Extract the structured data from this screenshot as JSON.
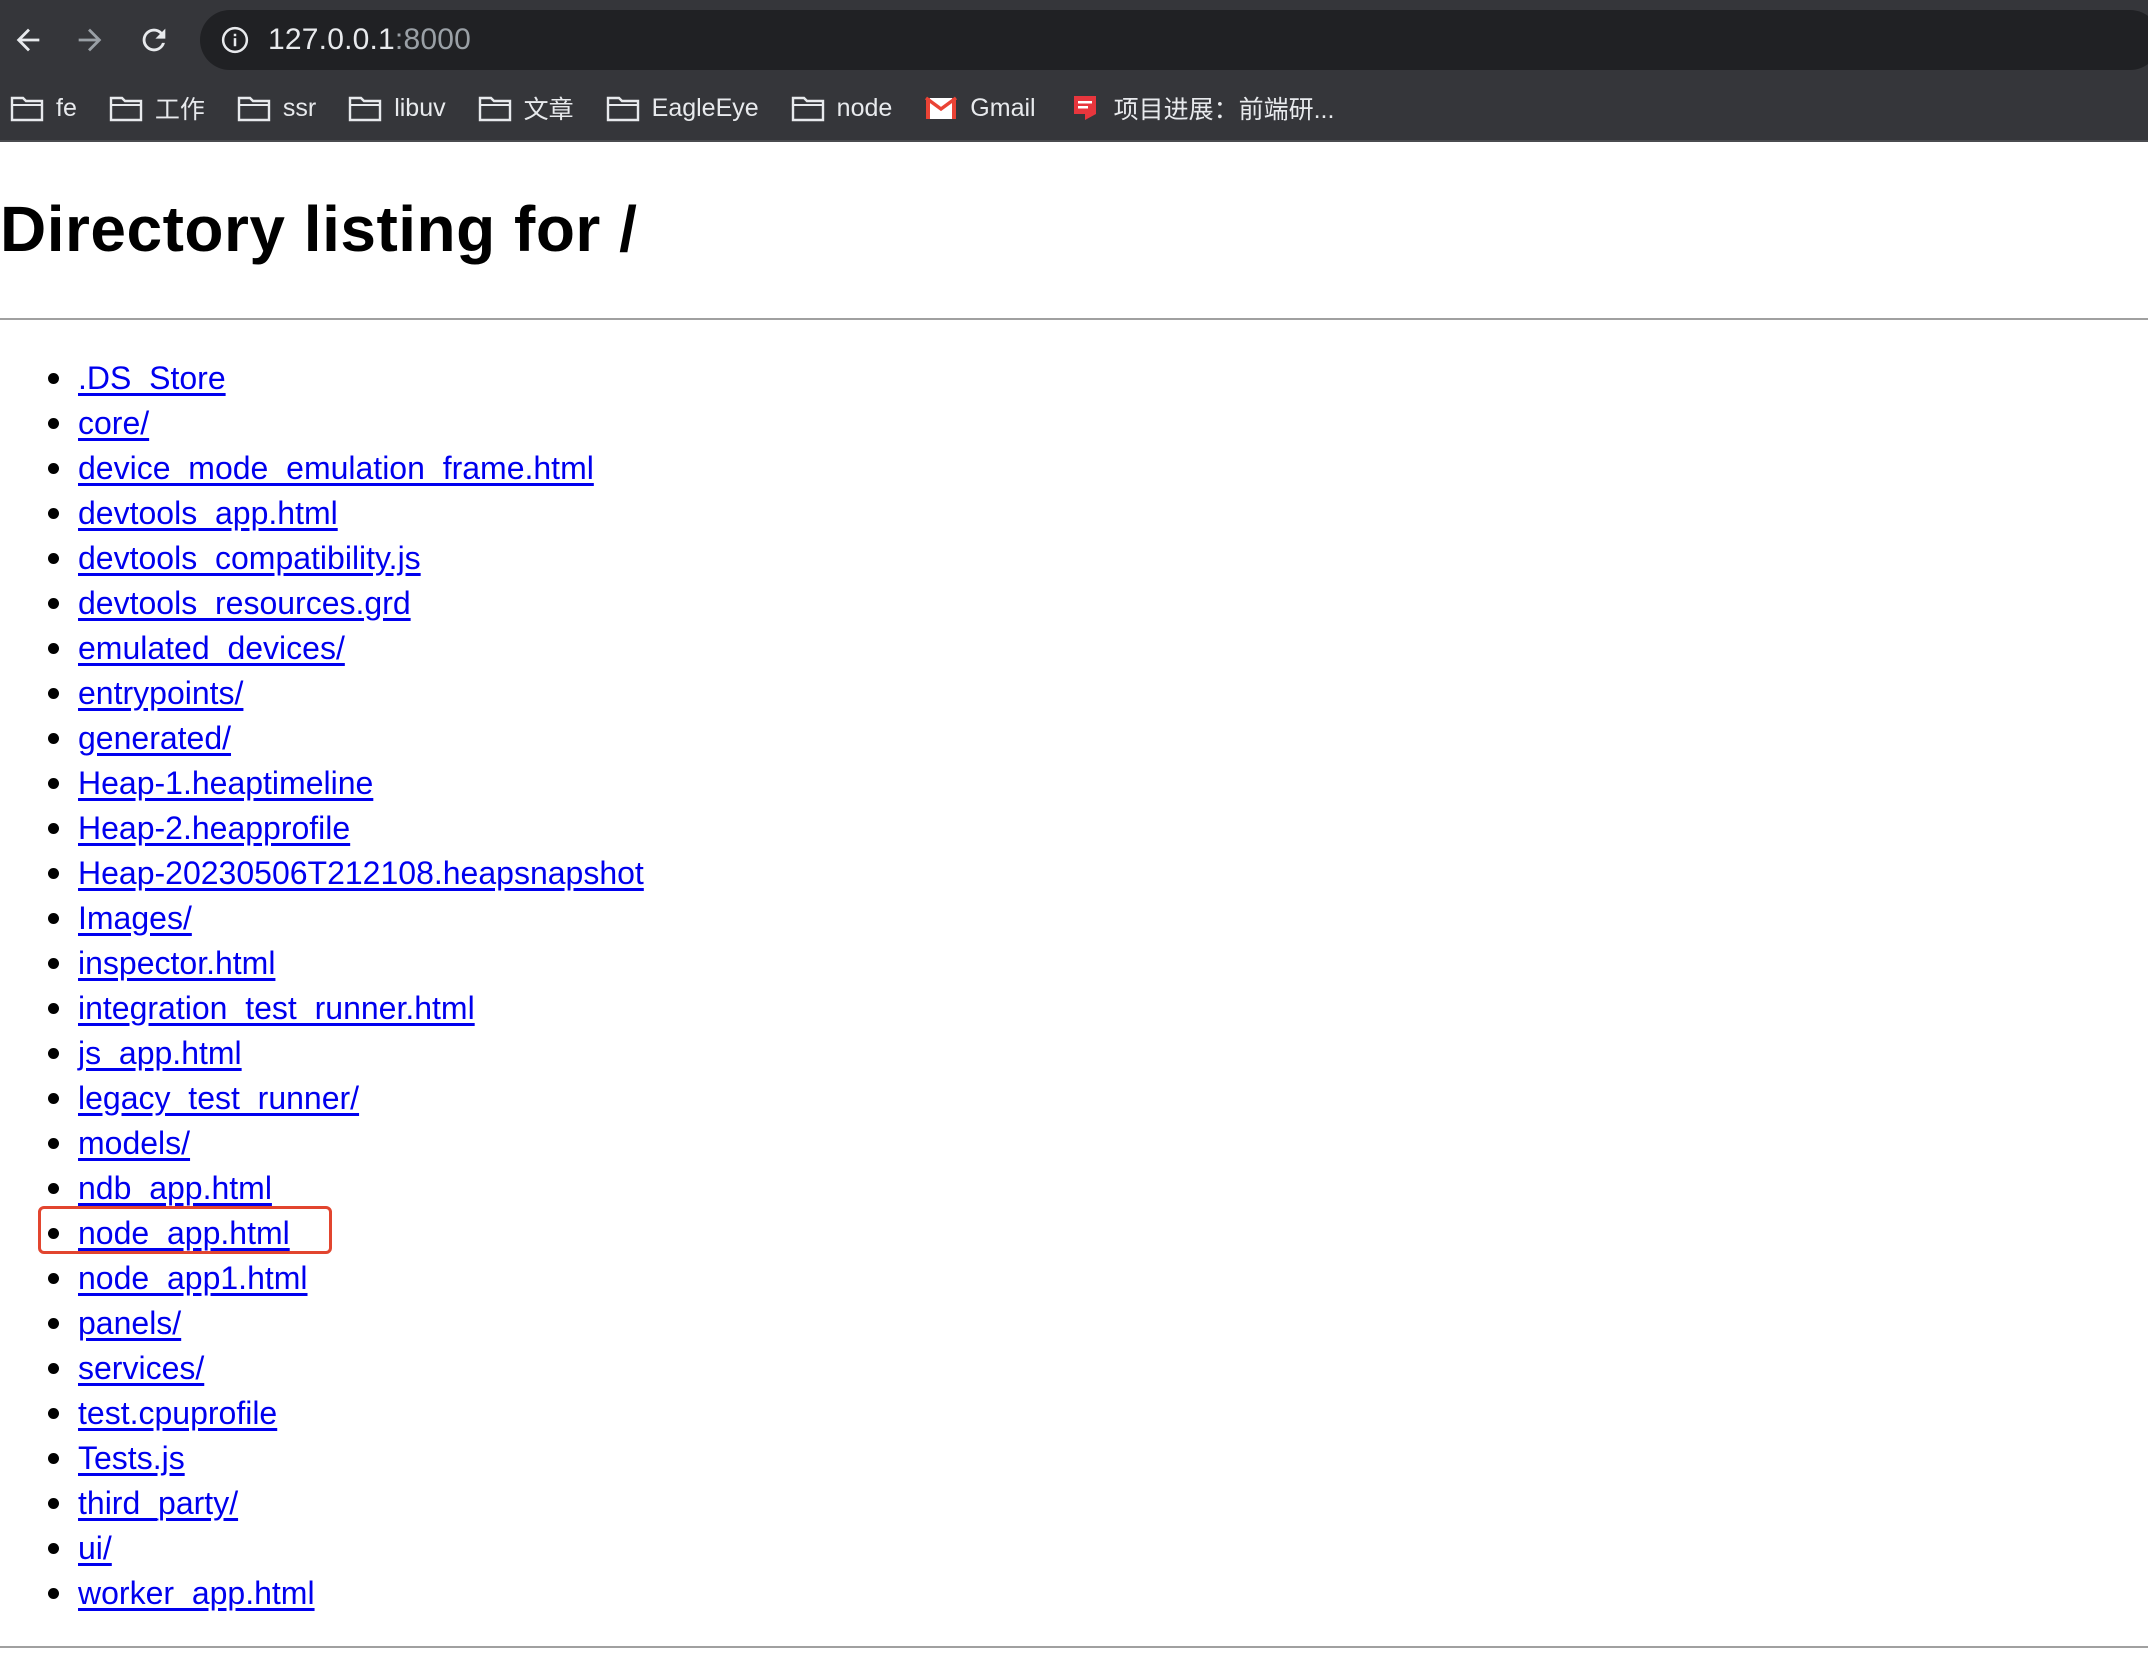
{
  "browser": {
    "url_host": "127.0.0.1",
    "url_port": ":8000",
    "bookmarks": [
      {
        "label": "fe",
        "icon": "folder-icon"
      },
      {
        "label": "工作",
        "icon": "folder-icon"
      },
      {
        "label": "ssr",
        "icon": "folder-icon"
      },
      {
        "label": "libuv",
        "icon": "folder-icon"
      },
      {
        "label": "文章",
        "icon": "folder-icon"
      },
      {
        "label": "EagleEye",
        "icon": "folder-icon"
      },
      {
        "label": "node",
        "icon": "folder-icon"
      },
      {
        "label": "Gmail",
        "icon": "gmail-icon"
      },
      {
        "label": "项目进展：前端研...",
        "icon": "doc-icon"
      }
    ],
    "colors": {
      "chrome": "#35363a",
      "omnibox": "#202124",
      "gmail_red": "#ea4335",
      "doc_red": "#e8363d"
    }
  },
  "page": {
    "title": "Directory listing for /",
    "entries": [
      ".DS_Store",
      "core/",
      "device_mode_emulation_frame.html",
      "devtools_app.html",
      "devtools_compatibility.js",
      "devtools_resources.grd",
      "emulated_devices/",
      "entrypoints/",
      "generated/",
      "Heap-1.heaptimeline",
      "Heap-2.heapprofile",
      "Heap-20230506T212108.heapsnapshot",
      "Images/",
      "inspector.html",
      "integration_test_runner.html",
      "js_app.html",
      "legacy_test_runner/",
      "models/",
      "ndb_app.html",
      "node_app.html",
      "node_app1.html",
      "panels/",
      "services/",
      "test.cpuprofile",
      "Tests.js",
      "third_party/",
      "ui/",
      "worker_app.html"
    ],
    "highlighted_entry": "node_app.html",
    "colors": {
      "link": "#0000ee",
      "highlight": "#e2452f"
    }
  }
}
